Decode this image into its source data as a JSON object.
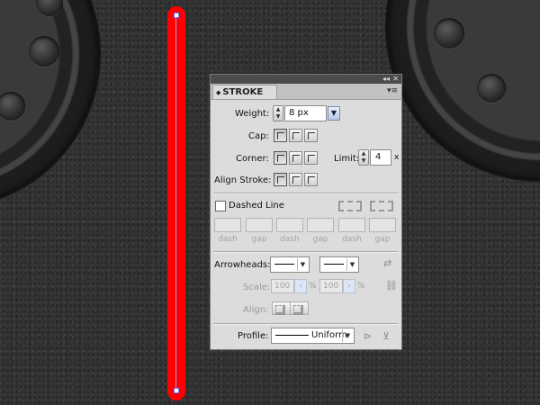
{
  "panel": {
    "tab_title": "STROKE",
    "weight": {
      "label": "Weight:",
      "value": "8 px"
    },
    "cap": {
      "label": "Cap:"
    },
    "corner": {
      "label": "Corner:"
    },
    "limit": {
      "label": "Limit:",
      "value": "4",
      "suffix": "x"
    },
    "align_stroke": {
      "label": "Align Stroke:"
    },
    "dashed_line": {
      "label": "Dashed Line",
      "checked": false
    },
    "dash_gap_labels": [
      "dash",
      "gap",
      "dash",
      "gap",
      "dash",
      "gap"
    ],
    "arrowheads": {
      "label": "Arrowheads:"
    },
    "scale": {
      "label": "Scale:",
      "start_value": "100",
      "end_value": "100",
      "unit": "%"
    },
    "align": {
      "label": "Align:"
    },
    "profile": {
      "label": "Profile:",
      "value": "Uniform"
    }
  },
  "colors": {
    "stroke": "#ff0000",
    "panel_bg": "#dcdcdc",
    "titlebar": "#4b4b4b"
  },
  "icons": [
    "collapse-icon",
    "close-icon",
    "panel-menu-icon",
    "swap-arrows-icon",
    "link-icon",
    "flip-horizontal-icon",
    "flip-vertical-icon"
  ]
}
